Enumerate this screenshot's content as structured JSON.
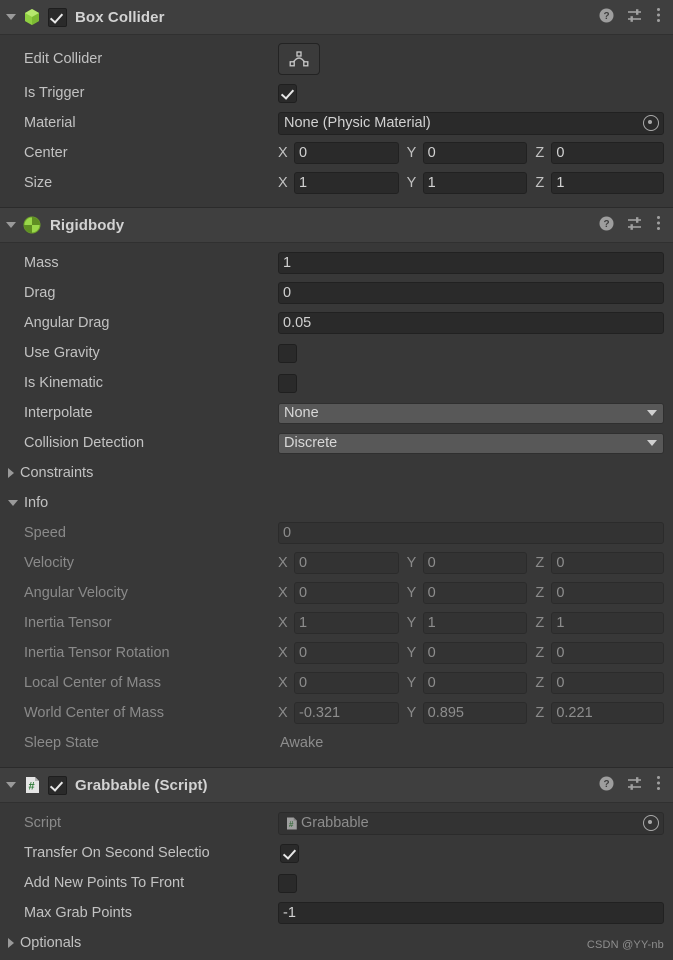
{
  "watermark": "CSDN @YY-nb",
  "header_icons": {
    "help": "help-icon",
    "preset": "preset-settings-icon",
    "menu": "more-menu-icon"
  },
  "components": [
    {
      "id": "box-collider",
      "title": "Box Collider",
      "icon": "box-collider-icon",
      "enabled": true,
      "has_enable_checkbox": true,
      "rows": {
        "edit_collider": {
          "label": "Edit Collider",
          "button": "edit-collider-button"
        },
        "is_trigger": {
          "label": "Is Trigger",
          "value": true
        },
        "material": {
          "label": "Material",
          "value": "None (Physic Material)"
        },
        "center": {
          "label": "Center",
          "x": "0",
          "y": "0",
          "z": "0"
        },
        "size": {
          "label": "Size",
          "x": "1",
          "y": "1",
          "z": "1"
        }
      }
    },
    {
      "id": "rigidbody",
      "title": "Rigidbody",
      "icon": "rigidbody-icon",
      "enabled": true,
      "has_enable_checkbox": false,
      "rows": {
        "mass": {
          "label": "Mass",
          "value": "1"
        },
        "drag": {
          "label": "Drag",
          "value": "0"
        },
        "angular_drag": {
          "label": "Angular Drag",
          "value": "0.05"
        },
        "use_gravity": {
          "label": "Use Gravity",
          "value": false
        },
        "is_kinematic": {
          "label": "Is Kinematic",
          "value": false
        },
        "interpolate": {
          "label": "Interpolate",
          "value": "None"
        },
        "collision_detection": {
          "label": "Collision Detection",
          "value": "Discrete"
        },
        "constraints": {
          "label": "Constraints",
          "expanded": false
        },
        "info": {
          "label": "Info",
          "expanded": true
        }
      },
      "info": {
        "speed": {
          "label": "Speed",
          "value": "0"
        },
        "velocity": {
          "label": "Velocity",
          "x": "0",
          "y": "0",
          "z": "0"
        },
        "angular_velocity": {
          "label": "Angular Velocity",
          "x": "0",
          "y": "0",
          "z": "0"
        },
        "inertia_tensor": {
          "label": "Inertia Tensor",
          "x": "1",
          "y": "1",
          "z": "1"
        },
        "inertia_tensor_rotation": {
          "label": "Inertia Tensor Rotation",
          "x": "0",
          "y": "0",
          "z": "0"
        },
        "local_center_of_mass": {
          "label": "Local Center of Mass",
          "x": "0",
          "y": "0",
          "z": "0"
        },
        "world_center_of_mass": {
          "label": "World Center of Mass",
          "x": "-0.321",
          "y": "0.895",
          "z": "0.221"
        },
        "sleep_state": {
          "label": "Sleep State",
          "value": "Awake"
        }
      }
    },
    {
      "id": "grabbable",
      "title": "Grabbable (Script)",
      "icon": "csharp-script-icon",
      "enabled": true,
      "has_enable_checkbox": true,
      "rows": {
        "script": {
          "label": "Script",
          "value": "Grabbable"
        },
        "transfer_on_second_selection": {
          "label": "Transfer On Second Selectio",
          "value": true
        },
        "add_new_points_to_front": {
          "label": "Add New Points To Front",
          "value": false
        },
        "max_grab_points": {
          "label": "Max Grab Points",
          "value": "-1"
        },
        "optionals": {
          "label": "Optionals",
          "expanded": false
        }
      }
    }
  ],
  "axis_labels": {
    "x": "X",
    "y": "Y",
    "z": "Z"
  },
  "colors": {
    "background": "#383838",
    "header": "#3f3f3f",
    "input": "#2a2a2a",
    "dropdown": "#585858",
    "accent_green": "#96d13b",
    "text": "#c2c2c2",
    "text_dim": "#8a8a8a"
  }
}
